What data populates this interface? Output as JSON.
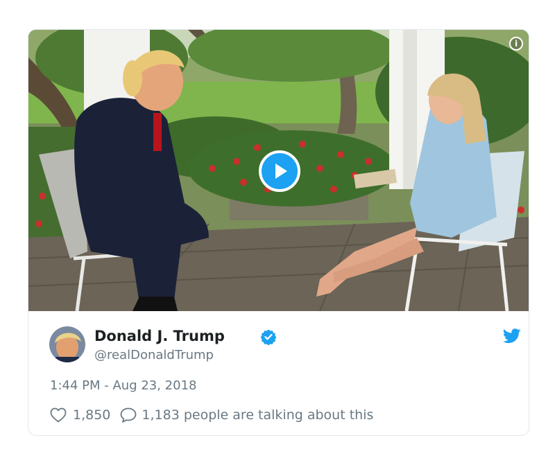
{
  "tweet": {
    "author_name": "Donald J. Trump",
    "author_handle": "@realDonaldTrump",
    "timestamp": "1:44 PM - Aug 23, 2018",
    "likes": "1,850",
    "replies_text": "1,183 people are talking about this"
  },
  "media": {
    "type": "video",
    "info_label": "i"
  },
  "icons": {
    "verified": "verified-badge-icon",
    "brand": "twitter-bird-icon",
    "like": "heart-outline-icon",
    "reply": "speech-bubble-icon",
    "play": "play-icon",
    "info": "info-icon"
  },
  "colors": {
    "accent": "#1da1f2",
    "text_primary": "#1c2022",
    "text_secondary": "#697882",
    "border": "#e1e8ed"
  }
}
